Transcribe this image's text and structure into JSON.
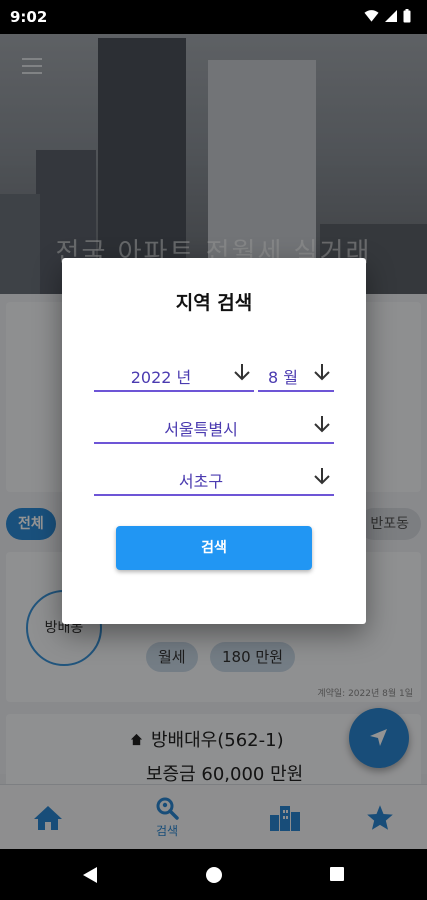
{
  "status_bar": {
    "time": "9:02"
  },
  "hero": {
    "title": "전국 아파트 전월세 실거래"
  },
  "filters": {
    "all_label": "전체",
    "dong_label": "반포동"
  },
  "listings": [
    {
      "circle": "방배동",
      "type": "월세",
      "rent": "180 만원",
      "contract_date": "계약일: 2022년 8월 1일"
    },
    {
      "name": "방배대우(562-1)",
      "deposit": "보증금 60,000 만원"
    }
  ],
  "bottom_nav": {
    "search_label": "검색"
  },
  "dialog": {
    "title": "지역 검색",
    "year": "2022 년",
    "month": "8 월",
    "city": "서울특별시",
    "district": "서초구",
    "search_button": "검색"
  },
  "colors": {
    "accent": "#2196f3",
    "field_underline": "#6d55d6",
    "nav_icon": "#2a86d0"
  }
}
